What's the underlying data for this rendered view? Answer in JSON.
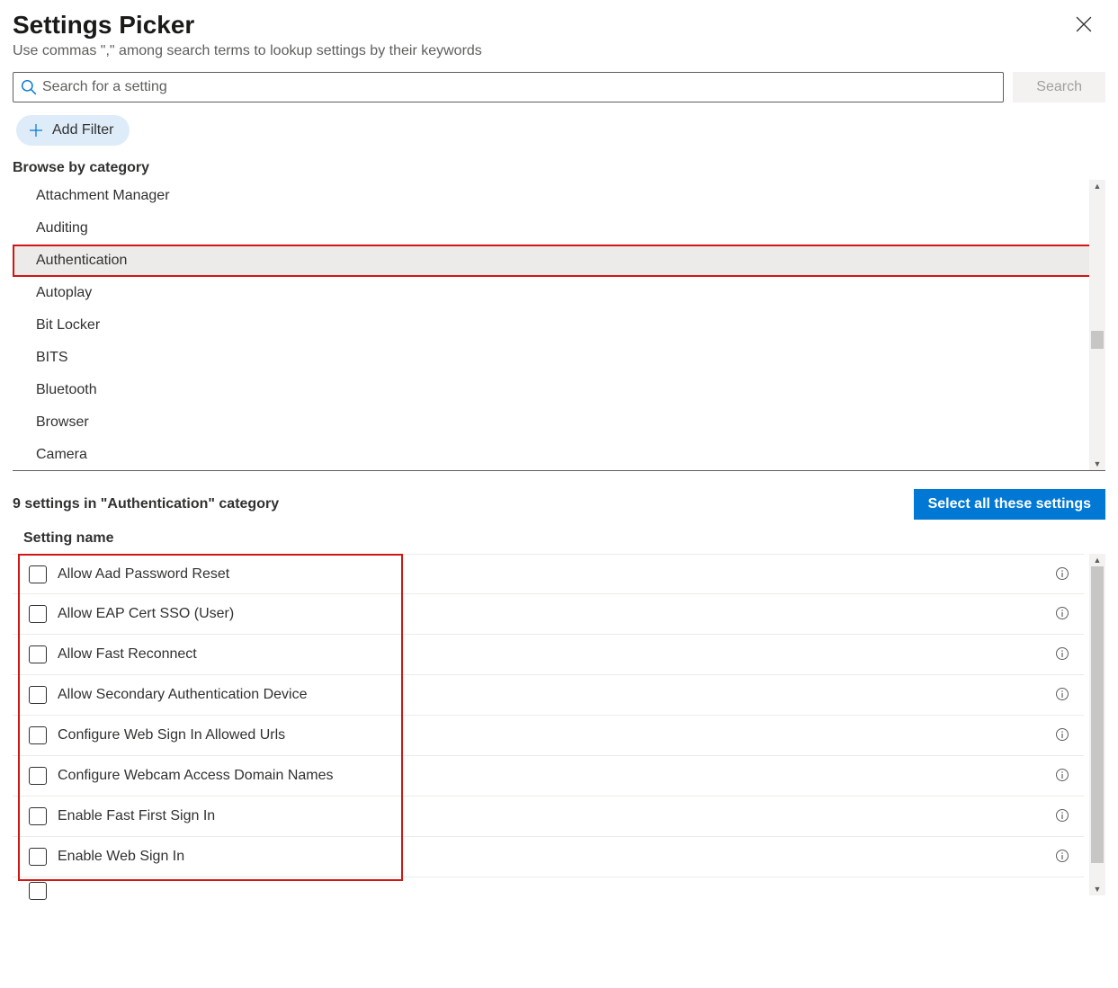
{
  "header": {
    "title": "Settings Picker",
    "subtitle": "Use commas \",\" among search terms to lookup settings by their keywords"
  },
  "search": {
    "placeholder": "Search for a setting",
    "button_label": "Search"
  },
  "filter": {
    "add_label": "Add Filter"
  },
  "browse": {
    "heading": "Browse by category",
    "categories": [
      {
        "label": "Attachment Manager",
        "selected": false
      },
      {
        "label": "Auditing",
        "selected": false
      },
      {
        "label": "Authentication",
        "selected": true
      },
      {
        "label": "Autoplay",
        "selected": false
      },
      {
        "label": "Bit Locker",
        "selected": false
      },
      {
        "label": "BITS",
        "selected": false
      },
      {
        "label": "Bluetooth",
        "selected": false
      },
      {
        "label": "Browser",
        "selected": false
      },
      {
        "label": "Camera",
        "selected": false
      }
    ]
  },
  "results": {
    "count_label": "9 settings in \"Authentication\" category",
    "select_all_label": "Select all these settings",
    "column_header": "Setting name",
    "settings": [
      {
        "label": "Allow Aad Password Reset",
        "checked": false
      },
      {
        "label": "Allow EAP Cert SSO (User)",
        "checked": false
      },
      {
        "label": "Allow Fast Reconnect",
        "checked": false
      },
      {
        "label": "Allow Secondary Authentication Device",
        "checked": false
      },
      {
        "label": "Configure Web Sign In Allowed Urls",
        "checked": false
      },
      {
        "label": "Configure Webcam Access Domain Names",
        "checked": false
      },
      {
        "label": "Enable Fast First Sign In",
        "checked": false
      },
      {
        "label": "Enable Web Sign In",
        "checked": false
      }
    ]
  },
  "colors": {
    "primary": "#0078d4",
    "highlight_border": "#d01713",
    "text": "#323130"
  }
}
